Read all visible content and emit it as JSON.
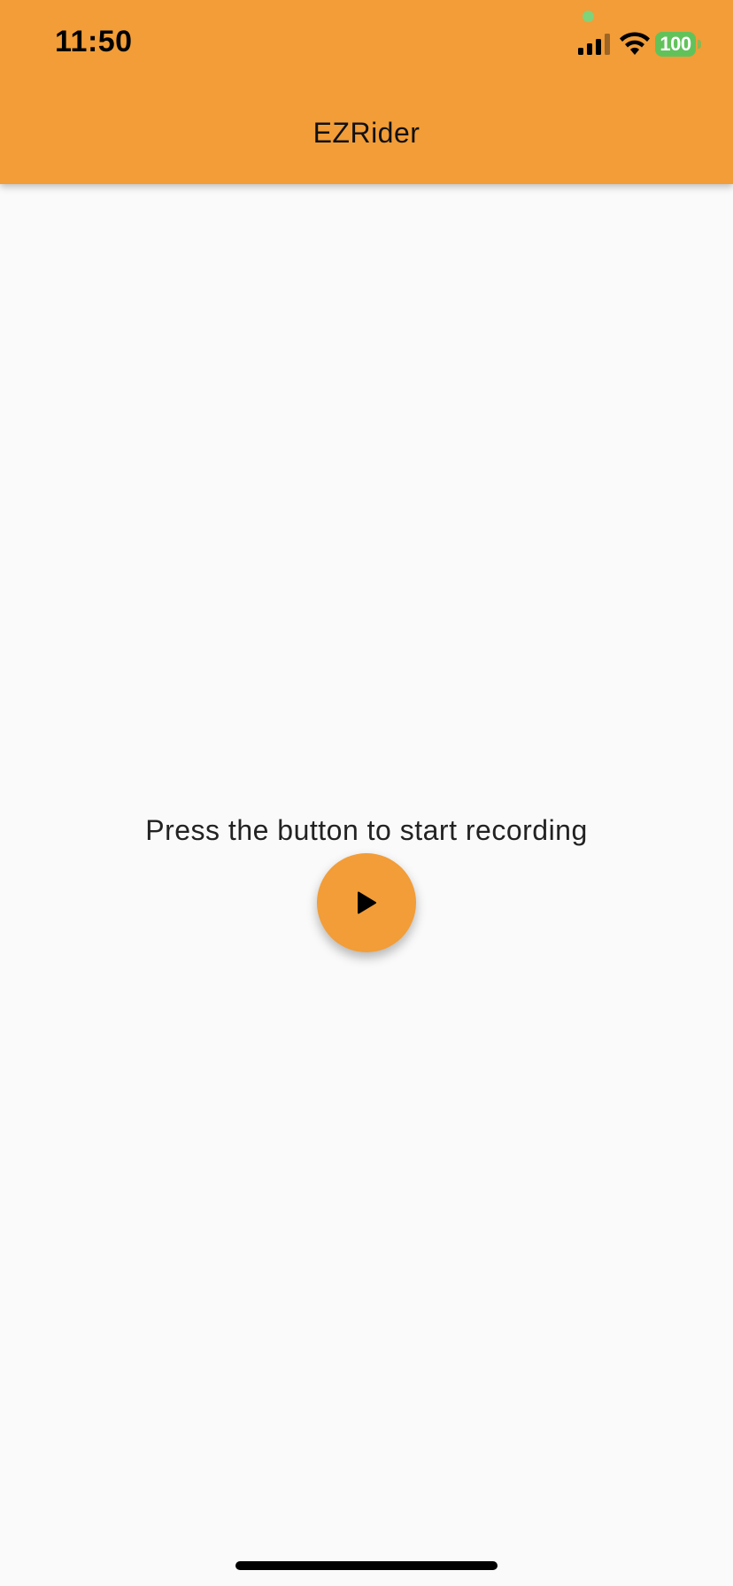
{
  "status_bar": {
    "time": "11:50",
    "battery_level": "100",
    "icons": [
      "cellular-signal-icon",
      "wifi-icon",
      "battery-icon"
    ],
    "privacy_indicator_color": "#7fd37a"
  },
  "app_bar": {
    "title": "EZRider",
    "background_color": "#f29d38"
  },
  "main": {
    "prompt": "Press the button to start recording",
    "record_button": {
      "icon": "play-icon",
      "color": "#f29d38"
    }
  }
}
